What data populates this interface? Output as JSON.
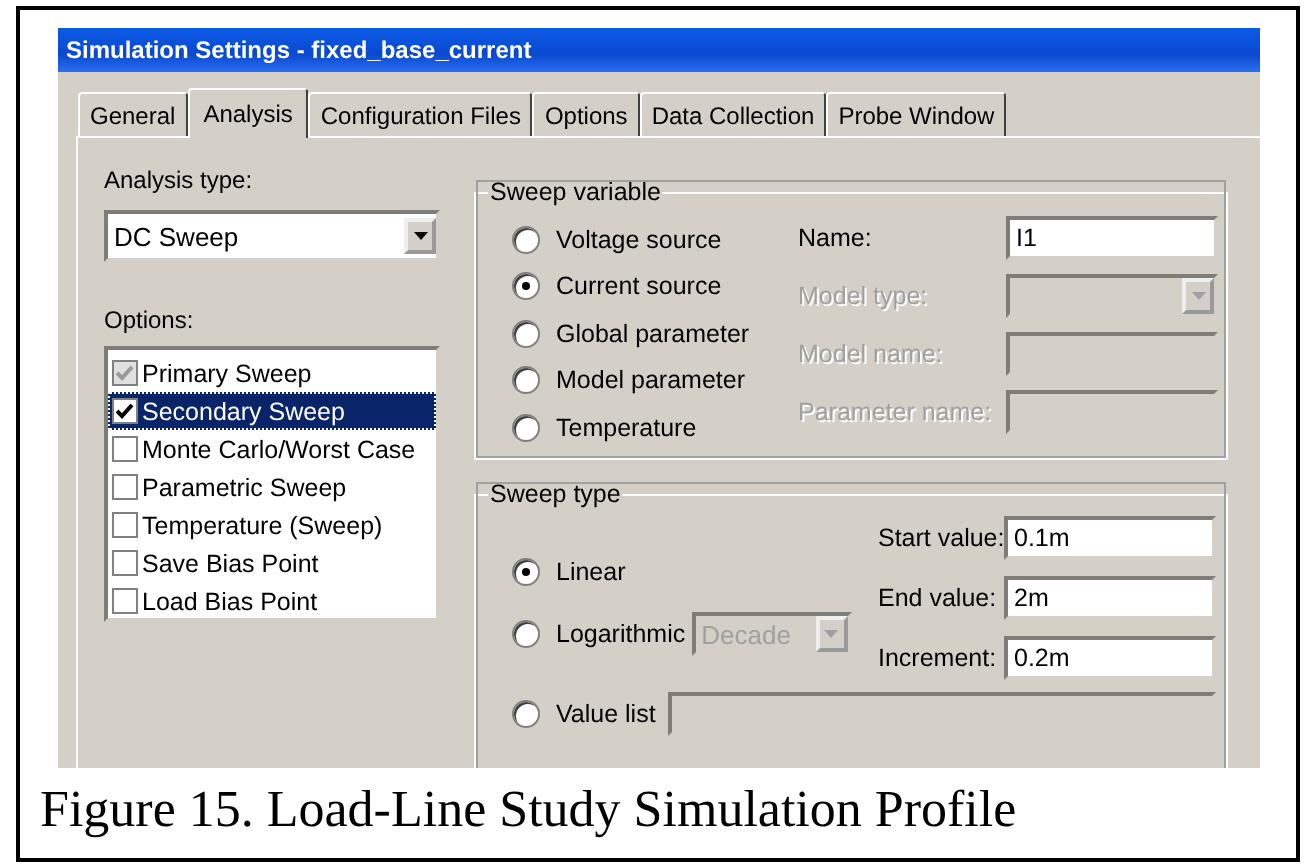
{
  "window": {
    "title": "Simulation Settings - fixed_base_current"
  },
  "tabs": [
    {
      "label": "General",
      "selected": false
    },
    {
      "label": "Analysis",
      "selected": true
    },
    {
      "label": "Configuration Files",
      "selected": false
    },
    {
      "label": "Options",
      "selected": false
    },
    {
      "label": "Data Collection",
      "selected": false
    },
    {
      "label": "Probe Window",
      "selected": false
    }
  ],
  "analysis_type": {
    "label": "Analysis type:",
    "value": "DC Sweep"
  },
  "options": {
    "label": "Options:",
    "items": [
      {
        "label": "Primary Sweep",
        "checked": true,
        "disabled": true,
        "selected": false
      },
      {
        "label": "Secondary Sweep",
        "checked": true,
        "disabled": false,
        "selected": true
      },
      {
        "label": "Monte Carlo/Worst Case",
        "checked": false,
        "disabled": false,
        "selected": false
      },
      {
        "label": "Parametric Sweep",
        "checked": false,
        "disabled": false,
        "selected": false
      },
      {
        "label": "Temperature (Sweep)",
        "checked": false,
        "disabled": false,
        "selected": false
      },
      {
        "label": "Save Bias Point",
        "checked": false,
        "disabled": false,
        "selected": false
      },
      {
        "label": "Load Bias Point",
        "checked": false,
        "disabled": false,
        "selected": false
      }
    ]
  },
  "sweep_variable": {
    "title": "Sweep variable",
    "choices": [
      {
        "label": "Voltage source",
        "selected": false
      },
      {
        "label": "Current source",
        "selected": true
      },
      {
        "label": "Global parameter",
        "selected": false
      },
      {
        "label": "Model parameter",
        "selected": false
      },
      {
        "label": "Temperature",
        "selected": false
      }
    ],
    "fields": [
      {
        "label": "Name:",
        "kind": "text",
        "value": "I1",
        "disabled": false
      },
      {
        "label": "Model type:",
        "kind": "dropdown",
        "disabled": true
      },
      {
        "label": "Model name:",
        "kind": "text",
        "disabled": true
      },
      {
        "label": "Parameter name:",
        "kind": "text",
        "disabled": true
      }
    ]
  },
  "sweep_type": {
    "title": "Sweep type",
    "choices": [
      {
        "label": "Linear",
        "selected": true
      },
      {
        "label": "Logarithmic",
        "selected": false,
        "dropdown": {
          "value": "Decade",
          "disabled": true
        }
      }
    ],
    "fields": [
      {
        "label": "Start value:",
        "value": "0.1m"
      },
      {
        "label": "End value:",
        "value": "2m"
      },
      {
        "label": "Increment:",
        "value": "0.2m"
      }
    ],
    "value_list": {
      "label": "Value list",
      "selected": false,
      "disabled": true
    }
  },
  "caption": "Figure 15.  Load-Line Study Simulation Profile"
}
